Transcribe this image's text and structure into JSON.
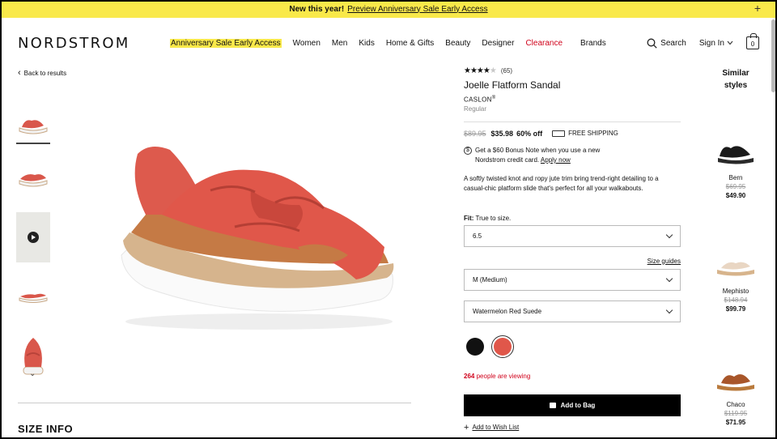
{
  "promo": {
    "lead": "New this year!",
    "link": "Preview Anniversary Sale Early Access"
  },
  "header": {
    "logo": "NORDSTROM",
    "nav": [
      "Anniversary Sale Early Access",
      "Women",
      "Men",
      "Kids",
      "Home & Gifts",
      "Beauty",
      "Designer",
      "Clearance",
      "Brands"
    ],
    "search": "Search",
    "signin": "Sign In",
    "bag_count": "0"
  },
  "back": "Back to results",
  "product": {
    "rating": 3.5,
    "stars_filled": "★★★★",
    "stars_empty": "★",
    "review_count": "(65)",
    "name": "Joelle Flatform Sandal",
    "brand": "CASLON",
    "fit_type": "Regular",
    "old_price": "$89.95",
    "price": "$35.98",
    "discount": "60% off",
    "shipping": "FREE SHIPPING",
    "bonus_note": "Get a $60 Bonus Note when you use a new Nordstrom credit card.",
    "apply": "Apply now",
    "description": "A softly twisted knot and ropy jute trim bring trend-right detailing to a casual-chic platform slide that's perfect for all your walkabouts.",
    "fit_label": "Fit:",
    "fit_value": "True to size.",
    "size": "6.5",
    "size_guides": "Size guides",
    "width": "M (Medium)",
    "color": "Watermelon Red Suede",
    "swatches": [
      "#111111",
      "#e0574a"
    ],
    "viewing_count": "264",
    "viewing_text": "people are viewing",
    "add_to_bag": "Add to Bag",
    "wishlist": "Add to Wish List",
    "accent_red": "#d0021b"
  },
  "similar": {
    "title_1": "Similar",
    "title_2": "styles",
    "items": [
      {
        "brand": "Bern",
        "old": "$69.95",
        "price": "$49.90"
      },
      {
        "brand": "Mephisto",
        "old": "$148.94",
        "price": "$99.79"
      },
      {
        "brand": "Chaco",
        "old": "$119.95",
        "price": "$71.95"
      }
    ]
  },
  "size_info": "SIZE INFO"
}
